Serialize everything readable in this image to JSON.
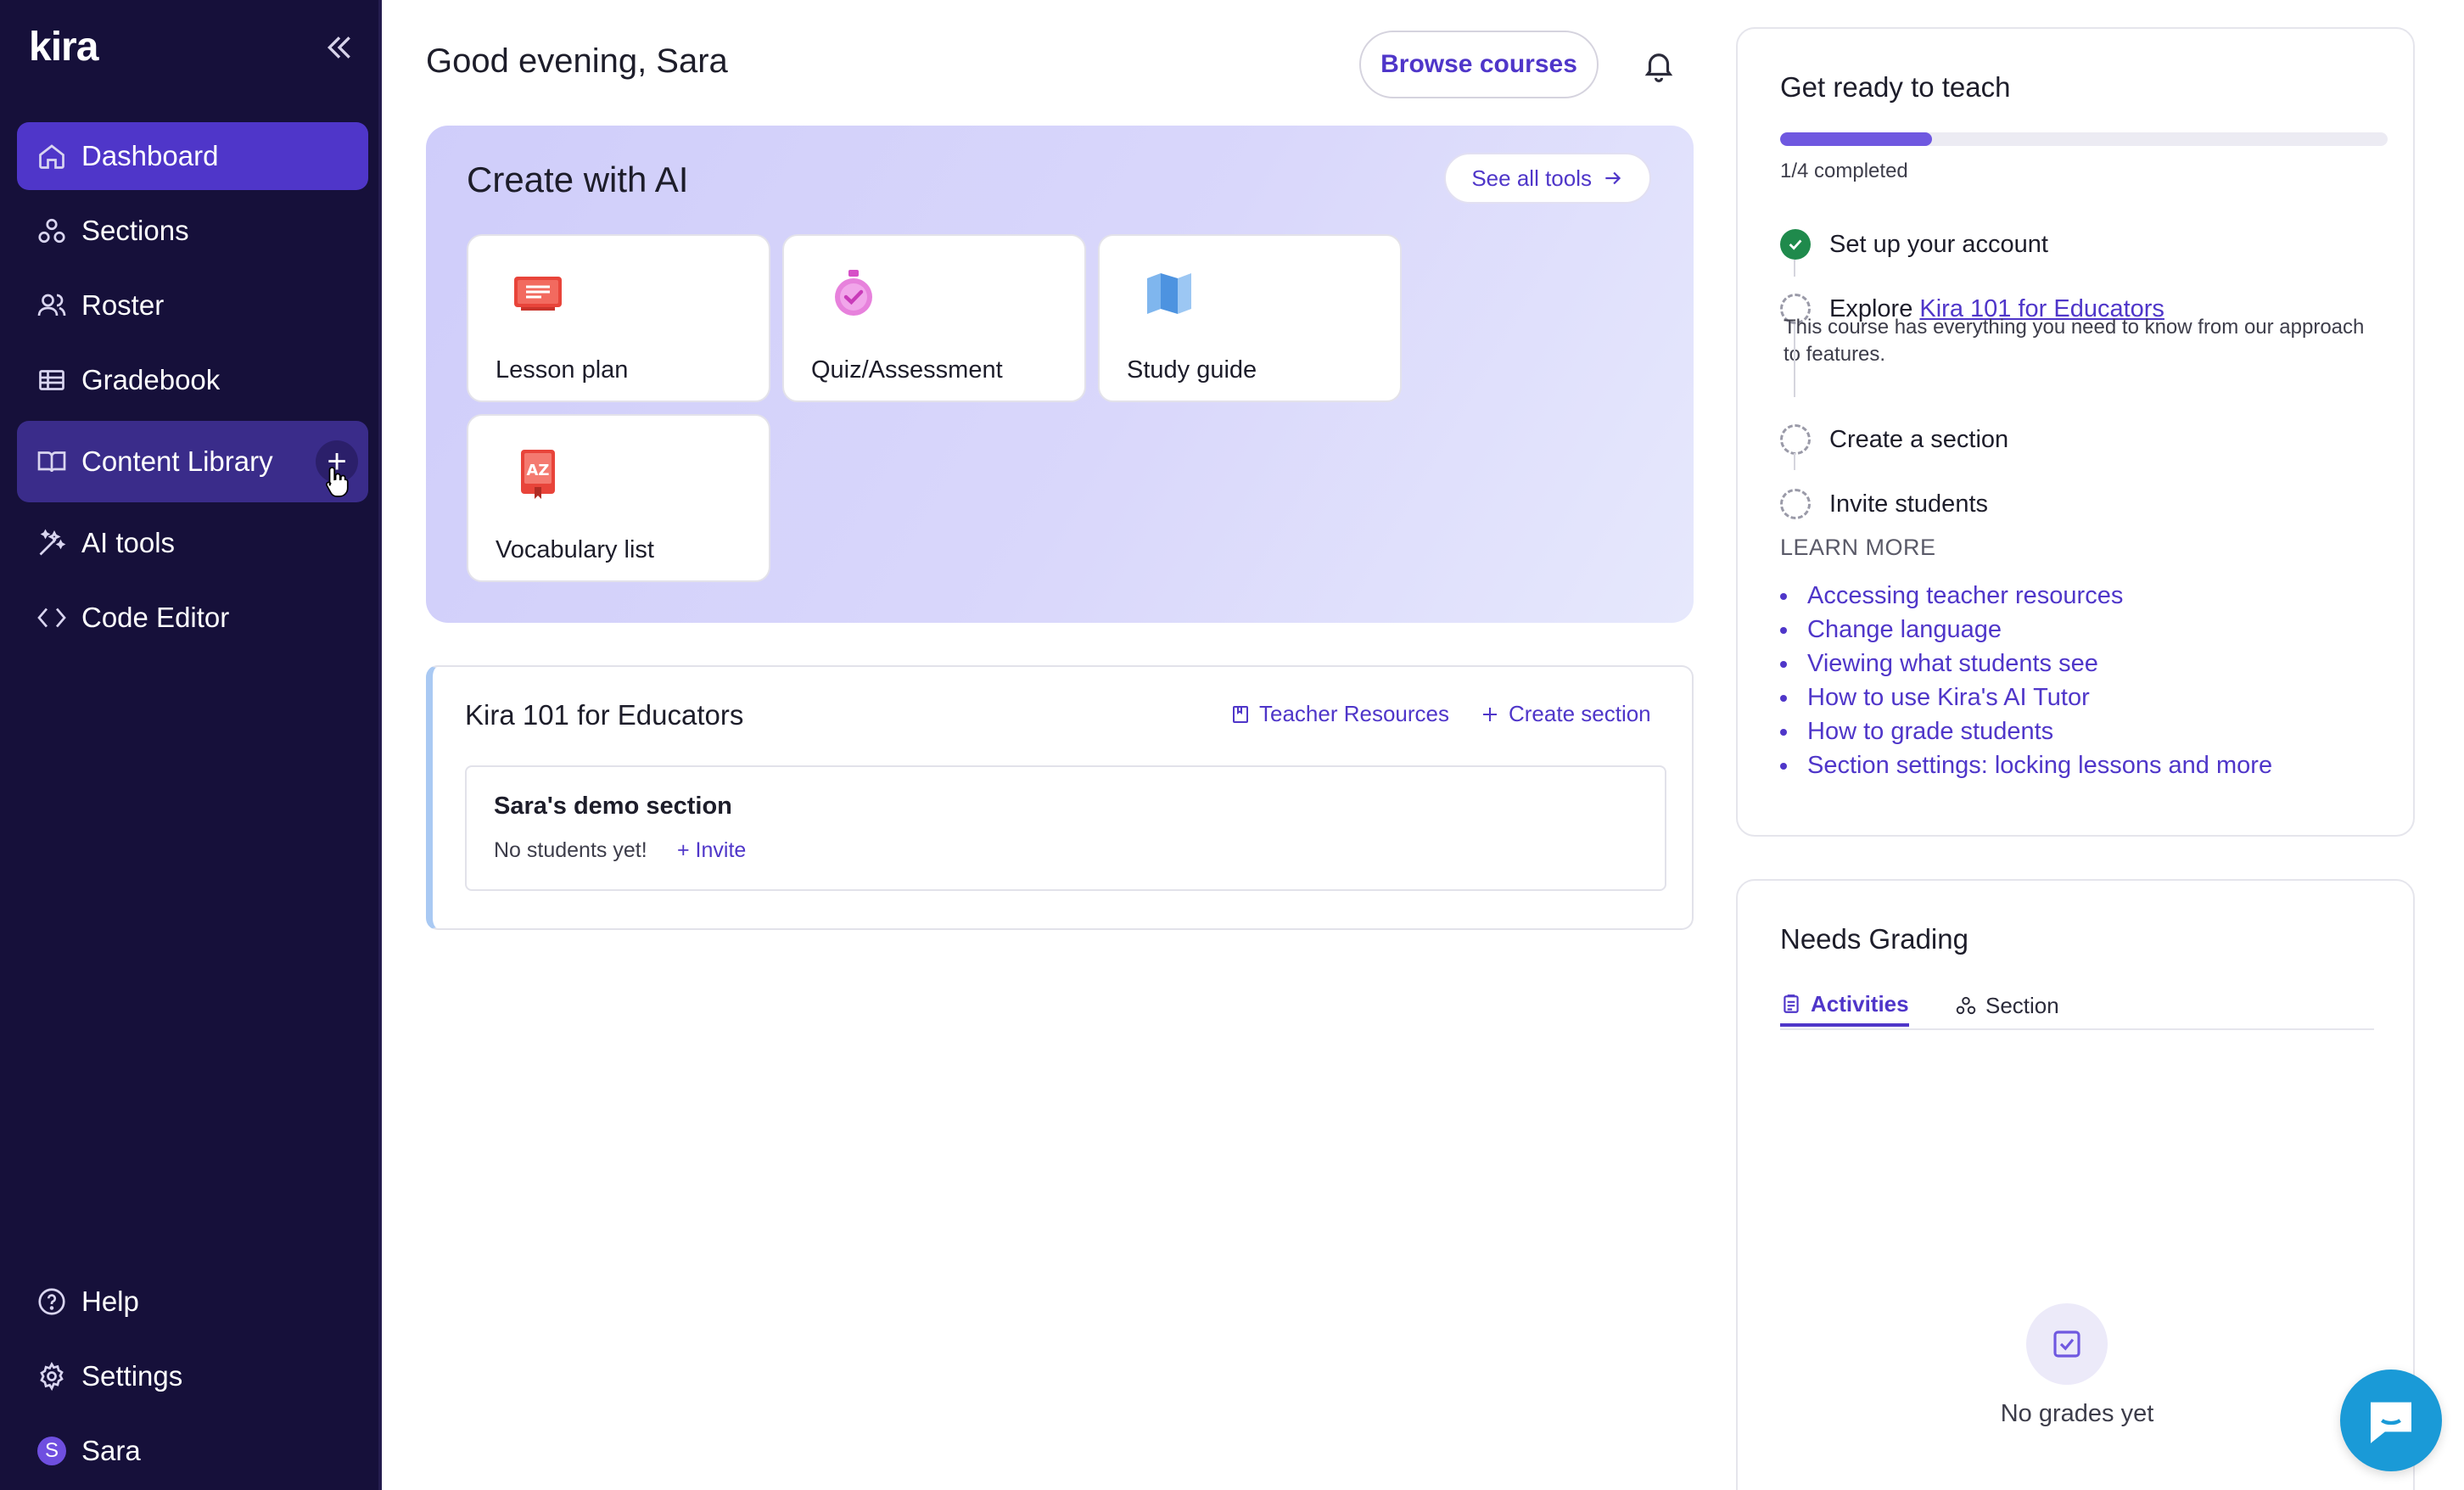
{
  "app": {
    "logo": "kira"
  },
  "sidebar": {
    "items": [
      {
        "label": "Dashboard",
        "icon": "home-icon"
      },
      {
        "label": "Sections",
        "icon": "sections-icon"
      },
      {
        "label": "Roster",
        "icon": "users-icon"
      },
      {
        "label": "Gradebook",
        "icon": "table-icon"
      },
      {
        "label": "Content Library",
        "icon": "book-icon",
        "action": "+"
      },
      {
        "label": "AI tools",
        "icon": "magic-wand-icon"
      },
      {
        "label": "Code Editor",
        "icon": "code-icon"
      }
    ],
    "bottom": [
      {
        "label": "Help",
        "icon": "help-icon"
      },
      {
        "label": "Settings",
        "icon": "gear-icon"
      },
      {
        "label": "Sara",
        "icon": "avatar",
        "initial": "S"
      }
    ]
  },
  "header": {
    "greeting": "Good evening, Sara",
    "browse_label": "Browse courses"
  },
  "create_ai": {
    "title": "Create with AI",
    "see_all": "See all tools",
    "tools": [
      {
        "label": "Lesson plan",
        "icon": "presentation-icon"
      },
      {
        "label": "Quiz/Assessment",
        "icon": "stopwatch-icon"
      },
      {
        "label": "Study guide",
        "icon": "map-icon"
      },
      {
        "label": "Vocabulary list",
        "icon": "dictionary-icon"
      }
    ]
  },
  "course": {
    "title": "Kira 101 for Educators",
    "teacher_resources": "Teacher Resources",
    "create_section": "Create section",
    "section_name": "Sara's demo section",
    "no_students": "No students yet!",
    "invite": "Invite"
  },
  "ready": {
    "title": "Get ready to teach",
    "progress": 0.25,
    "progress_text": "1/4 completed",
    "steps": [
      {
        "label": "Set up your account",
        "done": true
      },
      {
        "prefix": "Explore ",
        "link": "Kira 101 for Educators",
        "done": false,
        "desc": "This course has everything you need to know from our approach to features."
      },
      {
        "label": "Create a section",
        "done": false
      },
      {
        "label": "Invite students",
        "done": false
      }
    ],
    "learn_more_title": "LEARN MORE",
    "learn_more": [
      "Accessing teacher resources",
      "Change language",
      "Viewing what students see",
      "How to use Kira's AI Tutor",
      "How to grade students",
      "Section settings: locking lessons and more"
    ]
  },
  "grading": {
    "title": "Needs Grading",
    "tabs": [
      "Activities",
      "Section"
    ],
    "empty_text": "No grades yet"
  },
  "colors": {
    "sidebar_bg": "#16103a",
    "accent": "#4f36c9",
    "success": "#1f8a4c",
    "chat": "#1a9ad7"
  }
}
